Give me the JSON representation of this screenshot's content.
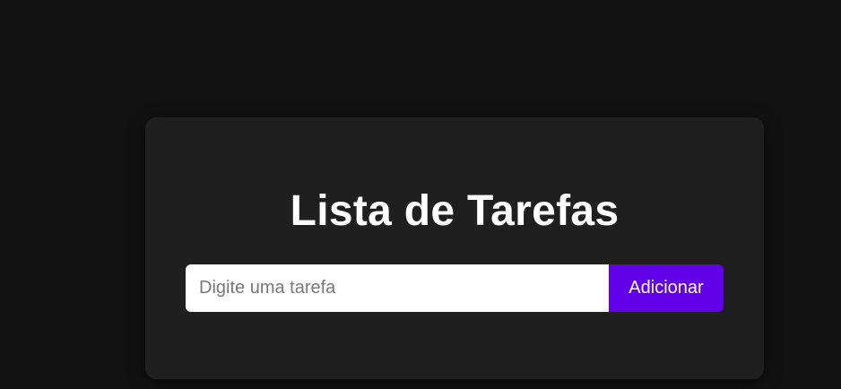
{
  "app": {
    "title": "Lista de Tarefas"
  },
  "task_form": {
    "input_value": "",
    "input_placeholder": "Digite uma tarefa",
    "add_button_label": "Adicionar"
  },
  "colors": {
    "page_background": "#121212",
    "card_background": "#1f1f1f",
    "accent": "#6200ea",
    "title_text": "#ffffff"
  },
  "tasks": []
}
